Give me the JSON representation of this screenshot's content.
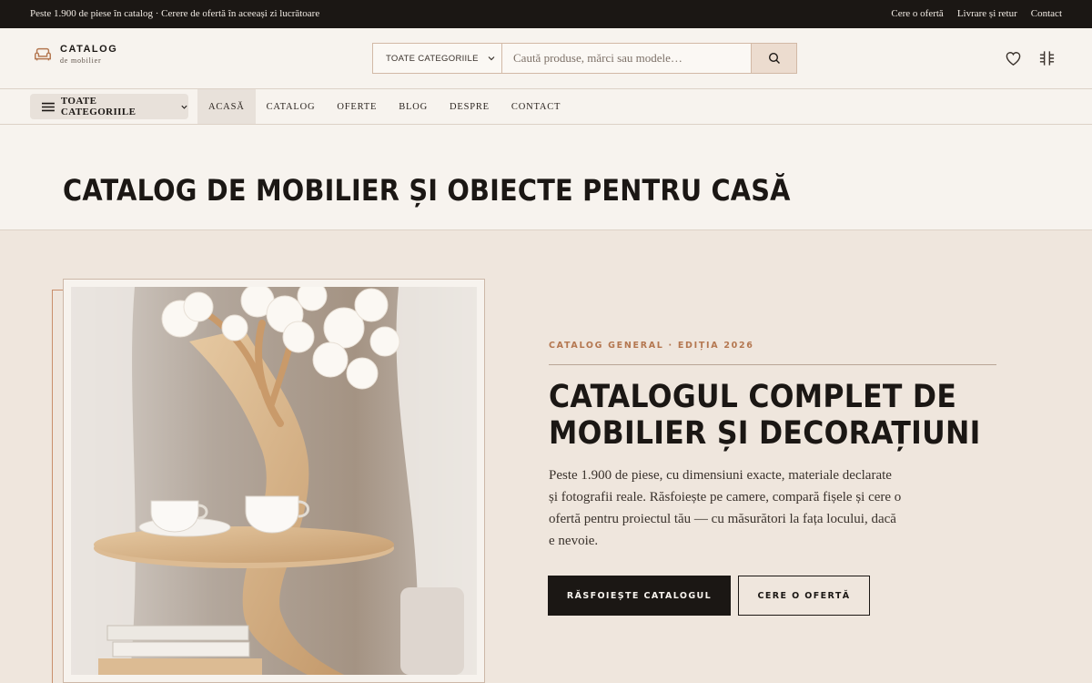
{
  "topbar": {
    "promo": "Peste 1.900 de piese în catalog · Cerere de ofertă în aceeași zi lucrătoare",
    "links": [
      "Cere o ofertă",
      "Livrare și retur",
      "Contact"
    ]
  },
  "header": {
    "logo_name": "CATALOG",
    "logo_sub": "de mobilier",
    "search": {
      "category": "TOATE CATEGORIILE",
      "placeholder": "Caută produse, mărci sau modele…"
    }
  },
  "nav": {
    "all_categories": "TOATE CATEGORIILE",
    "links": [
      "ACASĂ",
      "CATALOG",
      "OFERTE",
      "BLOG",
      "DESPRE",
      "CONTACT"
    ],
    "active": "ACASĂ"
  },
  "page": {
    "title": "CATALOG DE MOBILIER ȘI OBIECTE PENTRU CASĂ"
  },
  "hero": {
    "eyebrow": "CATALOG GENERAL · EDIȚIA 2026",
    "title_lines": [
      "CATALOGUL COMPLET DE",
      "MOBILIER ȘI DECORAȚIUNI"
    ],
    "description": "Peste 1.900 de piese, cu dimensiuni exacte, materiale declarate și fotografii reale. Răsfoiește pe camere, compară fișele și cere o ofertă pentru proiectul tău — cu măsurători la fața locului, dacă e nevoie.",
    "primary_button": "RĂSFOIEȘTE CATALOGUL",
    "secondary_button": "CERE O OFERTĂ"
  },
  "colors": {
    "dark": "#1b1714",
    "accent": "#b47750",
    "cream": "#f7f3ee",
    "beige": "#efe6dd"
  }
}
